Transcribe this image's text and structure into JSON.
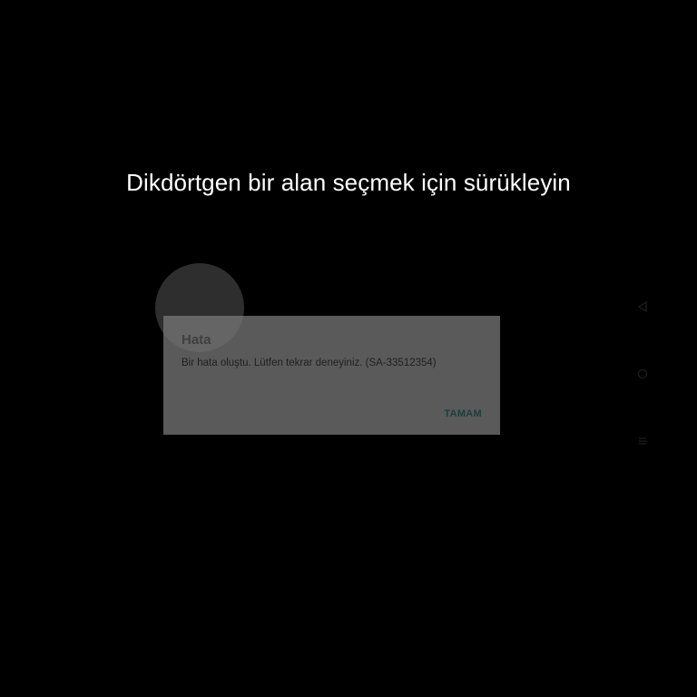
{
  "screen": {
    "instruction": "Dikdörtgen bir alan seçmek için sürükleyin"
  },
  "dialog": {
    "title": "Hata",
    "message": "Bir hata oluştu. Lütfen tekrar deneyiniz. (SA-33512354)",
    "ok_label": "TAMAM"
  },
  "navbar": {
    "back_icon": "back-triangle-icon",
    "home_icon": "home-circle-icon",
    "recents_icon": "recents-menu-icon"
  },
  "colors": {
    "background": "#000000",
    "dialog_bg": "#5a5a5a",
    "button_text": "#173f3c"
  }
}
